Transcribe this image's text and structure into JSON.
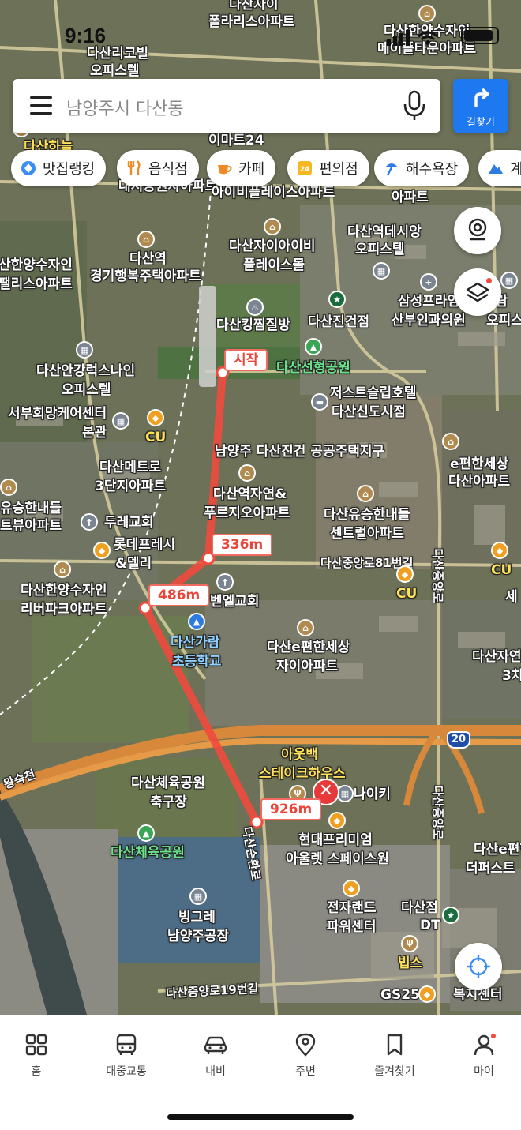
{
  "status": {
    "time": "9:16"
  },
  "search": {
    "placeholder": "남양주시 다산동",
    "directions_label": "길찾기"
  },
  "categories": [
    {
      "label": "맛집랭킹",
      "icon": "ranking-icon"
    },
    {
      "label": "음식점",
      "icon": "restaurant-icon"
    },
    {
      "label": "카페",
      "icon": "cafe-icon"
    },
    {
      "label": "편의점",
      "icon": "convenience-store-icon"
    },
    {
      "label": "해수욕장",
      "icon": "beach-icon"
    },
    {
      "label": "계",
      "icon": "mountain-icon"
    }
  ],
  "route": {
    "start_label": "시작",
    "distances": [
      "336m",
      "486m",
      "926m"
    ],
    "color": "#f04a3e"
  },
  "map_labels": {
    "top_apt1": "다산자이",
    "polaris": "폴라리스아파트",
    "maple1": "다산한양수자인",
    "maple2": "메이플타운아파트",
    "dasan_ri1": "다산리코빌",
    "dasan_ri2": "오피스텔",
    "dasan_pl1": "다산하늘",
    "emart": "이마트24",
    "daesung": "대지공원자아파트",
    "ivy1": "아이비플레이스아파트",
    "station_dasi1": "다산역데시앙",
    "station_dasi2": "오피스텔",
    "hj_apt": "아파트",
    "daesan_station": "다산역",
    "gyeonggi": "경기행복주택아파트",
    "dasan_ivy1": "다산자이아이비",
    "dasan_ivy2": "플레이스몰",
    "hanyang_left1": "산한양수자인",
    "hanyang_left2": "팰리스아파트",
    "samsung1": "삼성프라임",
    "samsung2": "산부인과의원",
    "jaram1": "자람",
    "jaram2": "오피스",
    "king": "다산킹찜질방",
    "jingeon": "다산진건점",
    "seonhyung": "다산선형공원",
    "gangni1": "다산안강럭스나인",
    "gangni2": "오피스텔",
    "jeoseu": "저스트슬립호텔",
    "sinsi": "다산신도시점",
    "seobu1": "서부희망케어센터",
    "seobu2": "본관",
    "cu1": "CU",
    "namyang": "남양주 다산진건 공공주택지구",
    "metro1": "다산메트로",
    "metro2": "3단지아파트",
    "epyeon1": "e편한세상",
    "epyeon2": "다산아파트",
    "yeokjeon1": "다산역자연&",
    "yeokjeon2": "푸르지오아파트",
    "yusong_left1": "유승한내들",
    "yusong_left2": "트뷰아파트",
    "durae": "두레교회",
    "lotte1": "롯데프레시",
    "lotte2": "&델리",
    "yusong1": "다산유승한내들",
    "yusong2": "센트럴아파트",
    "dasan81": "다산중앙로81번길",
    "cu2": "CU",
    "cu3": "CU",
    "se": "세",
    "hanyang_river1": "다산한양수자인",
    "hanyang_river2": "리버파크아파트",
    "bethel": "벧엘교회",
    "garam1": "다산가람",
    "garam2": "초등학교",
    "epyeon_xi1": "다산e편한세상",
    "epyeon_xi2": "자이아파트",
    "dasan_jayeon1": "다산자연",
    "dasan_jayeon2": "3차",
    "sapyeong": "다산중앙로",
    "outback1": "아웃백",
    "outback2": "스테이크하우스",
    "nike": "나이키",
    "sports1": "다산체육공원",
    "sports2": "축구장",
    "sports3": "다산체육공원",
    "hyundai1": "현대프리미엄",
    "hyundai2": "아울렛 스페이스원",
    "epyeon_right1": "다산e편한",
    "epyeon_right2": "더퍼스트",
    "jeonja1": "전자랜드",
    "jeonja2": "파워센터",
    "dasanjeom": "다산점",
    "dt": "DT",
    "bing1": "빙그레",
    "bing2": "남양주공장",
    "bips": "빕스",
    "gs25": "GS25",
    "bokji": "복지센터",
    "jungang19": "다산중앙로19번길",
    "jungang_road": "다산중앙로",
    "dasansunhwan": "다산순환로",
    "wangsuk": "왕숙천",
    "route20": "20"
  },
  "nav": [
    {
      "label": "홈",
      "icon": "home-grid-icon"
    },
    {
      "label": "대중교통",
      "icon": "bus-icon"
    },
    {
      "label": "내비",
      "icon": "car-icon"
    },
    {
      "label": "주변",
      "icon": "location-pin-icon"
    },
    {
      "label": "즐겨찾기",
      "icon": "bookmark-icon"
    },
    {
      "label": "마이",
      "icon": "profile-icon"
    }
  ]
}
